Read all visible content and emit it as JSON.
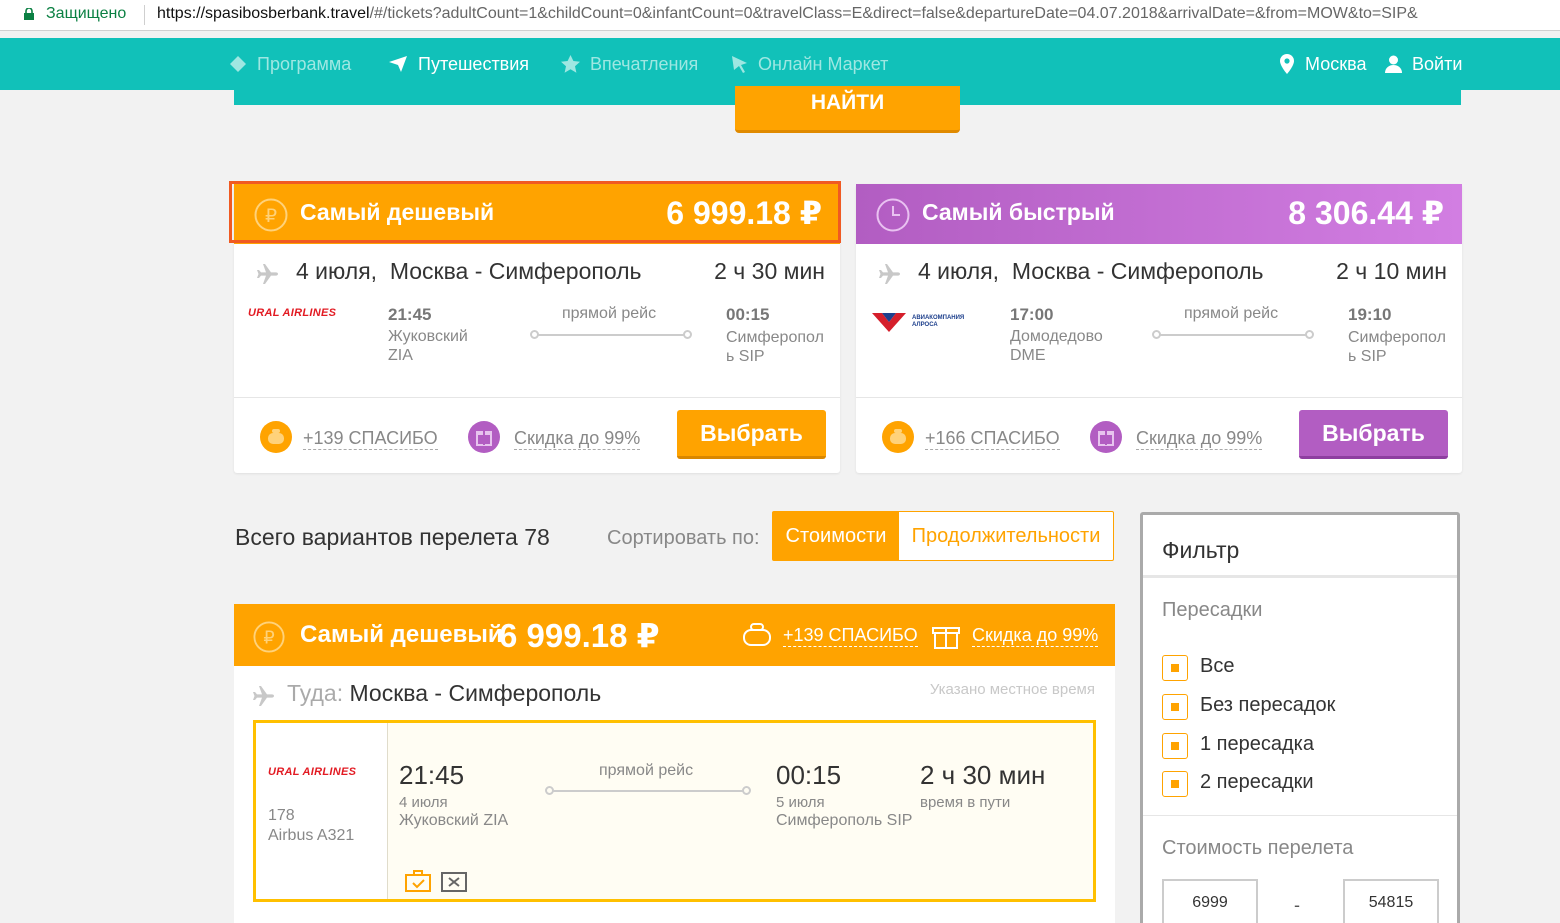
{
  "browser": {
    "secure_label": "Защищено",
    "url_host": "https://spasibosberbank.travel",
    "url_rest": "/#/tickets?adultCount=1&childCount=0&infantCount=0&travelClass=E&direct=false&departureDate=04.07.2018&arrivalDate=&from=MOW&to=SIP&"
  },
  "nav": {
    "items": [
      {
        "label": "Программа",
        "icon": "diamond-icon"
      },
      {
        "label": "Путешествия",
        "icon": "paper-plane-icon"
      },
      {
        "label": "Впечатления",
        "icon": "star-icon"
      },
      {
        "label": "Онлайн Маркет",
        "icon": "cursor-icon"
      }
    ],
    "city": "Москва",
    "login": "Войти",
    "find_button": "НАЙТИ"
  },
  "cards": [
    {
      "title": "Самый дешевый",
      "price": "6 999.18 ₽",
      "date": "4 июля,",
      "route": "Москва - Симферополь",
      "duration": "2 ч 30 мин",
      "airline": "URAL AIRLINES",
      "dep_time": "21:45",
      "dep_airport": "Жуковский",
      "dep_code": "ZIA",
      "direct": "прямой рейс",
      "arr_time": "00:15",
      "arr_airport": "Симферопол ь SIP",
      "bonus": "+139 СПАСИБО",
      "discount": "Скидка до 99%",
      "button": "Выбрать"
    },
    {
      "title": "Самый быстрый",
      "price": "8 306.44 ₽",
      "date": "4 июля,",
      "route": "Москва - Симферополь",
      "duration": "2 ч 10 мин",
      "airline": "АВИАКОМПАНИЯ АЛРОСА",
      "dep_time": "17:00",
      "dep_airport": "Домодедово",
      "dep_code": "DME",
      "direct": "прямой рейс",
      "arr_time": "19:10",
      "arr_airport": "Симферопол ь SIP",
      "bonus": "+166 СПАСИБО",
      "discount": "Скидка до 99%",
      "button": "Выбрать"
    }
  ],
  "results": {
    "total": "Всего вариантов перелета 78",
    "sort_label": "Сортировать по:",
    "sort_options": [
      "Стоимости",
      "Продолжительности"
    ],
    "sort_active": "Стоимости"
  },
  "result_card": {
    "title": "Самый дешевый",
    "price": "6 999.18 ₽",
    "bonus": "+139 СПАСИБО",
    "discount": "Скидка до 99%",
    "direction_label": "Туда:",
    "route": "Москва - Симферополь",
    "local_time_note": "Указано местное время",
    "segment": {
      "airline": "URAL AIRLINES",
      "flight_no": "178",
      "aircraft": "Airbus A321",
      "dep_time": "21:45",
      "dep_date": "4 июля",
      "dep_airport": "Жуковский ZIA",
      "direct": "прямой рейс",
      "arr_time": "00:15",
      "arr_date": "5 июля",
      "arr_airport": "Симферополь SIP",
      "duration": "2 ч 30 мин",
      "duration_label": "время в пути"
    }
  },
  "filter": {
    "title": "Фильтр",
    "transfers_label": "Пересадки",
    "options": [
      "Все",
      "Без пересадок",
      "1 пересадка",
      "2 пересадки"
    ],
    "price_label": "Стоимость перелета",
    "price_min": "6999",
    "price_sep": "-",
    "price_max": "54815"
  },
  "colors": {
    "nav": "#11c1b9",
    "accent": "#ffa300",
    "purple": "#b25dc2",
    "highlight": "#f05a22"
  }
}
